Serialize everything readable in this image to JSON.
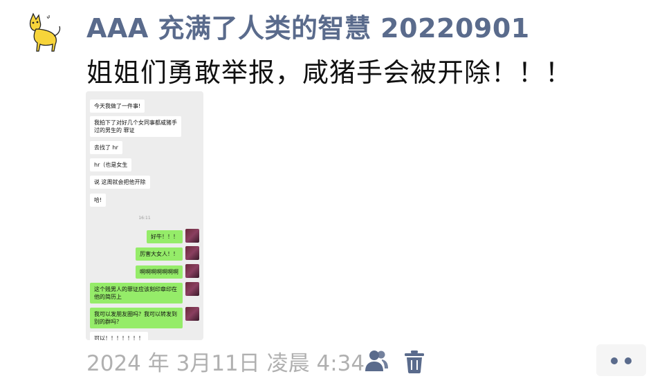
{
  "post": {
    "author": "AAA 充满了人类的智慧 20220901",
    "text": "姐姐们勇敢举报，咸猪手会被开除！！！",
    "date": "2024 年 3月11日 凌晨 4:34"
  },
  "screenshot": {
    "incoming": [
      "今天我做了一件事!",
      "我拍下了对好几个女同事都咸猪手过的男生的 罪证",
      "去找了 hr",
      "hr（也是女生",
      "说 这周就会把他开除",
      "哈!"
    ],
    "time": "16:11",
    "outgoing": [
      "好牛！！！",
      "厉害大女人！！",
      "啊啊啊啊啊啊啊",
      "这个贱男人的罪证应该刻印章印在他的简历上",
      "我可以发朋友圈吗？我可以转发到别的群吗？",
      "可以！！！！！！！"
    ]
  },
  "icons": {
    "avatar": "cat-avatar-icon",
    "people": "people-icon",
    "trash": "trash-icon",
    "more": "more-dots-icon"
  },
  "colors": {
    "author": "#5a6b8c",
    "bubble_out": "#95ec69",
    "date": "#b0b0b0"
  }
}
